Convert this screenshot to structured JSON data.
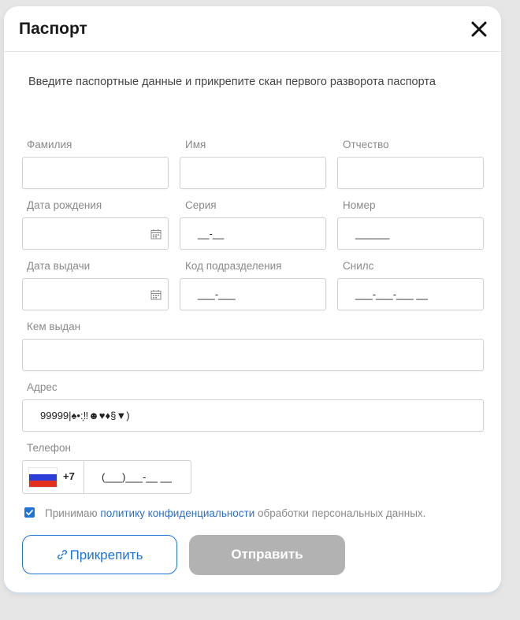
{
  "modal": {
    "title": "Паспорт",
    "description": "Введите паспортные данные и прикрепите скан первого разворота паспорта"
  },
  "fields": {
    "lastname": {
      "label": "Фамилия",
      "value": ""
    },
    "firstname": {
      "label": "Имя",
      "value": ""
    },
    "patronymic": {
      "label": "Отчество",
      "value": ""
    },
    "birthdate": {
      "label": "Дата рождения",
      "value": ""
    },
    "series": {
      "label": "Серия",
      "mask": "__-__"
    },
    "number": {
      "label": "Номер",
      "mask": "______"
    },
    "issue_date": {
      "label": "Дата выдачи",
      "value": ""
    },
    "division_code": {
      "label": "Код подразделения",
      "mask": "___-___"
    },
    "snils": {
      "label": "Снилс",
      "mask": "___-___-___ __"
    },
    "issued_by": {
      "label": "Кем выдан",
      "value": ""
    },
    "address": {
      "label": "Адрес",
      "value": "99999|♠•:̗‼☻♥♦§▼)"
    },
    "phone": {
      "label": "Телефон",
      "country_code": "+7",
      "mask": "(___)___-__ __"
    }
  },
  "consent": {
    "checked": true,
    "text_before": "Принимаю ",
    "link_text": "политику конфиденциальности",
    "text_after": " обработки персональных данных."
  },
  "buttons": {
    "attach_label": "Прикрепить",
    "send_label": "Отправить"
  },
  "colors": {
    "accent": "#1e73d8",
    "disabled_button": "#b2b2b2",
    "background": "#e6e6e6"
  },
  "icons": {
    "close": "close-icon",
    "calendar": "calendar-icon",
    "link": "link-icon",
    "flag": "russia-flag-icon"
  }
}
